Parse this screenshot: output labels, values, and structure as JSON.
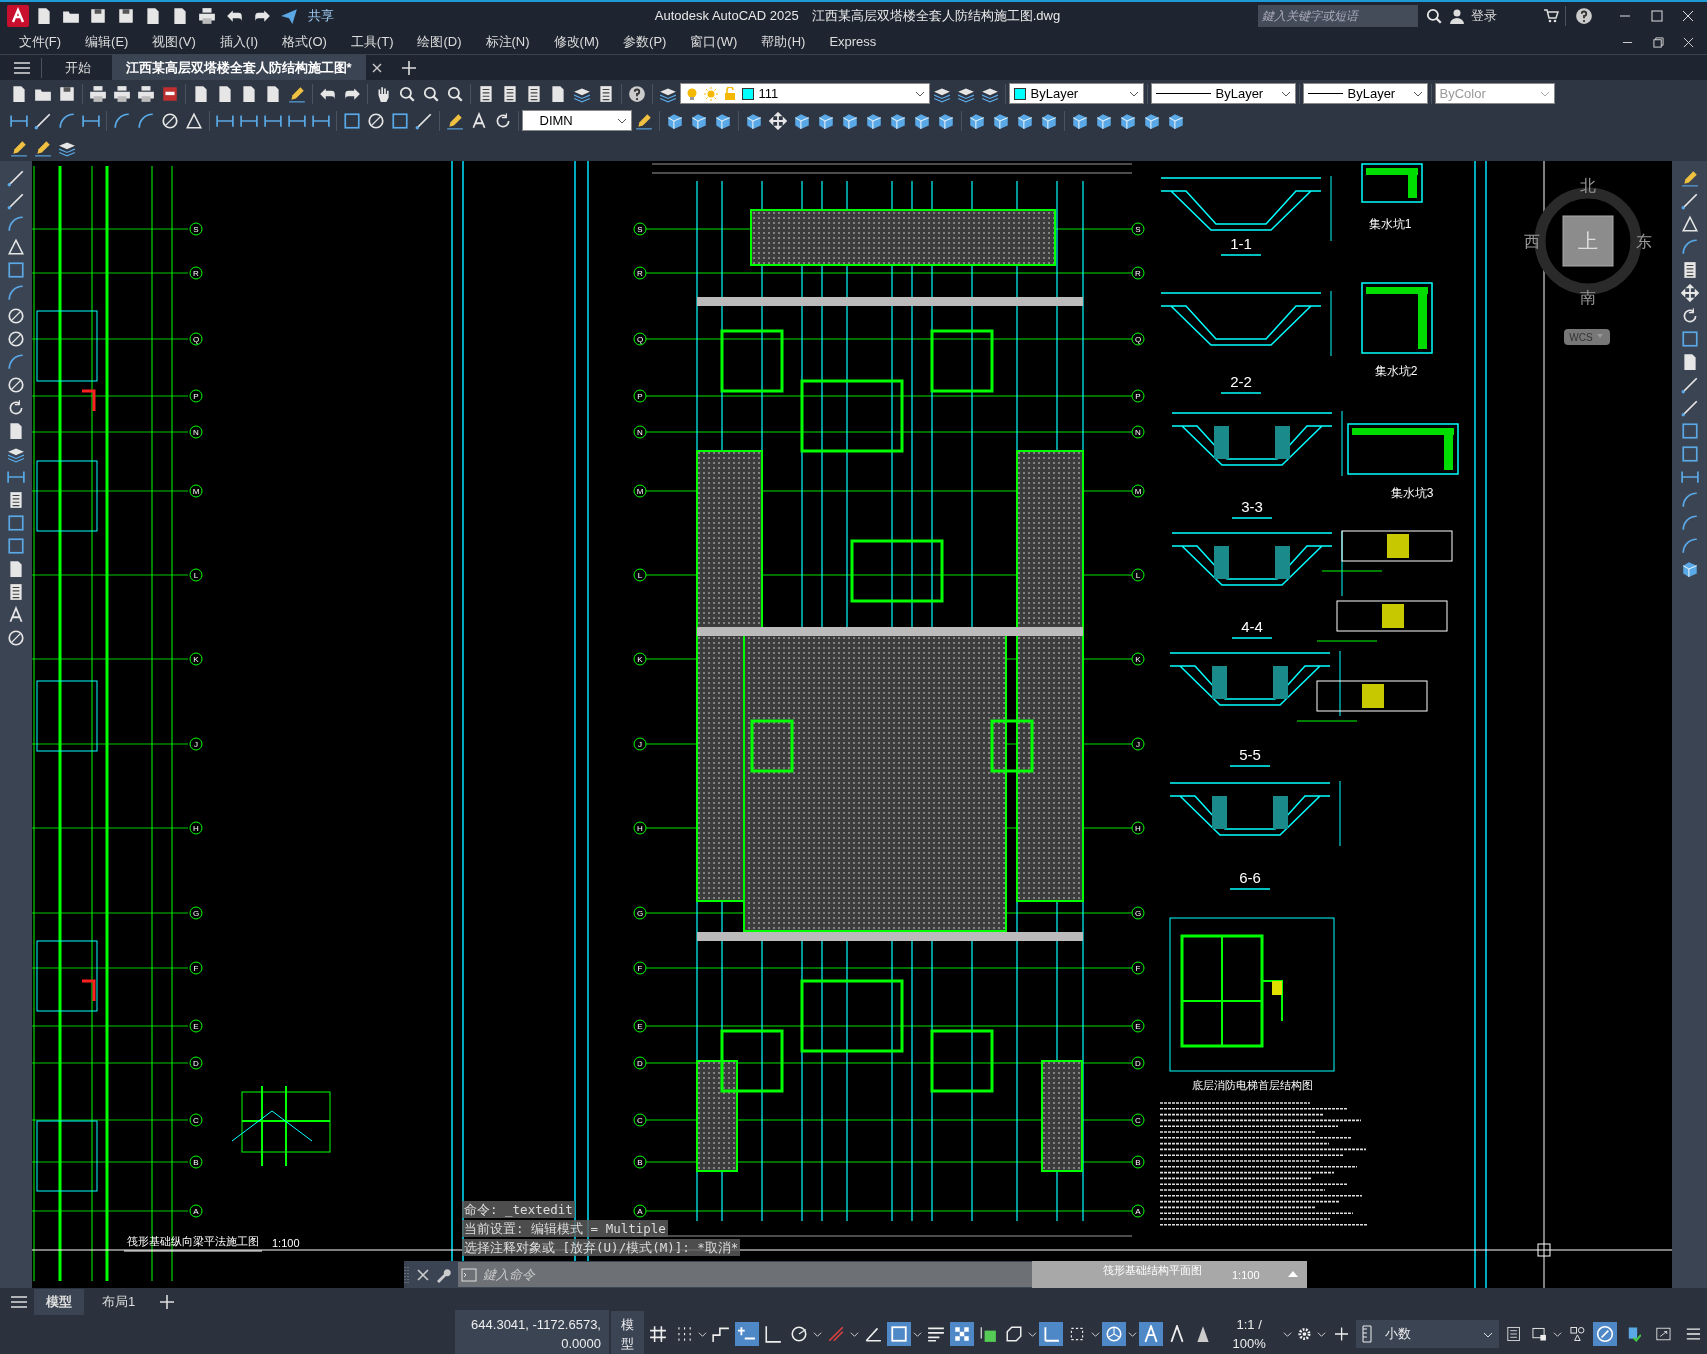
{
  "title_bar": {
    "app_title": "Autodesk AutoCAD 2025",
    "document_title": "江西某高层双塔楼全套人防结构施工图.dwg",
    "share": "共享",
    "search": {
      "placeholder": "鍵入关键字或短语"
    },
    "sign_in": "登录"
  },
  "menu_bar": [
    "文件(F)",
    "编辑(E)",
    "视图(V)",
    "插入(I)",
    "格式(O)",
    "工具(T)",
    "绘图(D)",
    "标注(N)",
    "修改(M)",
    "参数(P)",
    "窗口(W)",
    "帮助(H)",
    "Express"
  ],
  "file_tabs": [
    {
      "label": "开始",
      "selected": false
    },
    {
      "label": "江西某高层双塔楼全套人防结构施工图*",
      "selected": true
    }
  ],
  "toolbar": {
    "layer": "111",
    "dim_style": "DIMN",
    "object_setting": "ByLayer",
    "linetype": "ByLayer",
    "lineweight": "ByLayer",
    "plot_style": "ByColor"
  },
  "drawing": {
    "grid_axes_left_plan": [
      "S",
      "R",
      "Q",
      "P",
      "N",
      "M",
      "L",
      "K",
      "J",
      "H",
      "G",
      "F",
      "E",
      "D",
      "C",
      "B",
      "A"
    ],
    "grid_axes_main_left": [
      "S",
      "R",
      "Q",
      "P",
      "N",
      "M",
      "L",
      "K",
      "J",
      "H",
      "G",
      "F",
      "E",
      "D",
      "C",
      "B",
      "A"
    ],
    "grid_axes_main_right": [
      "S",
      "R",
      "Q",
      "P",
      "N",
      "M",
      "L",
      "K",
      "J",
      "H",
      "G",
      "F",
      "E",
      "D",
      "C",
      "B",
      "A"
    ],
    "section_labels": [
      "1-1",
      "2-2",
      "3-3",
      "4-4",
      "5-5",
      "6-6"
    ],
    "pit_labels": [
      "集水坑1",
      "集水坑2",
      "集水坑3"
    ],
    "elevator_title": "底层消防电梯首层结构图",
    "beam_plan_title": "筏形基础纵向梁平法施工图",
    "beam_plan_scale": "1:100",
    "foundation_plan_title": "筏形基础结构平面图",
    "foundation_plan_scale": "1:100"
  },
  "view_cube": {
    "north": "北",
    "south": "南",
    "east": "东",
    "west": "西",
    "face": "上",
    "ucs": "WCS"
  },
  "command_line": {
    "history": [
      "命令: _textedit",
      "当前设置: 编辑模式 = Multiple",
      "选择注释对象或 [放弃(U)/模式(M)]: *取消*"
    ],
    "placeholder": "鍵入命令"
  },
  "layout_tabs": [
    {
      "label": "模型",
      "selected": true
    },
    {
      "label": "布局1",
      "selected": false
    }
  ],
  "status_bar": {
    "coordinates": "644.3041, -1172.6573, 0.0000",
    "space": "模型",
    "annotation_scale": "1:1 / 100%",
    "units": "小数",
    "toggles": [
      {
        "on": false
      },
      {
        "on": false
      },
      {
        "on": false
      },
      {
        "on": true
      },
      {
        "on": false
      },
      {
        "on": false
      },
      {
        "on": false
      },
      {
        "on": false
      },
      {
        "on": true
      },
      {
        "on": false
      },
      {
        "on": true
      },
      {
        "on": false
      },
      {
        "on": false
      },
      {
        "on": true
      },
      {
        "on": false
      },
      {
        "on": true
      },
      {
        "on": true
      },
      {
        "on": false
      },
      {
        "on": false
      },
      {
        "on": true
      }
    ]
  }
}
